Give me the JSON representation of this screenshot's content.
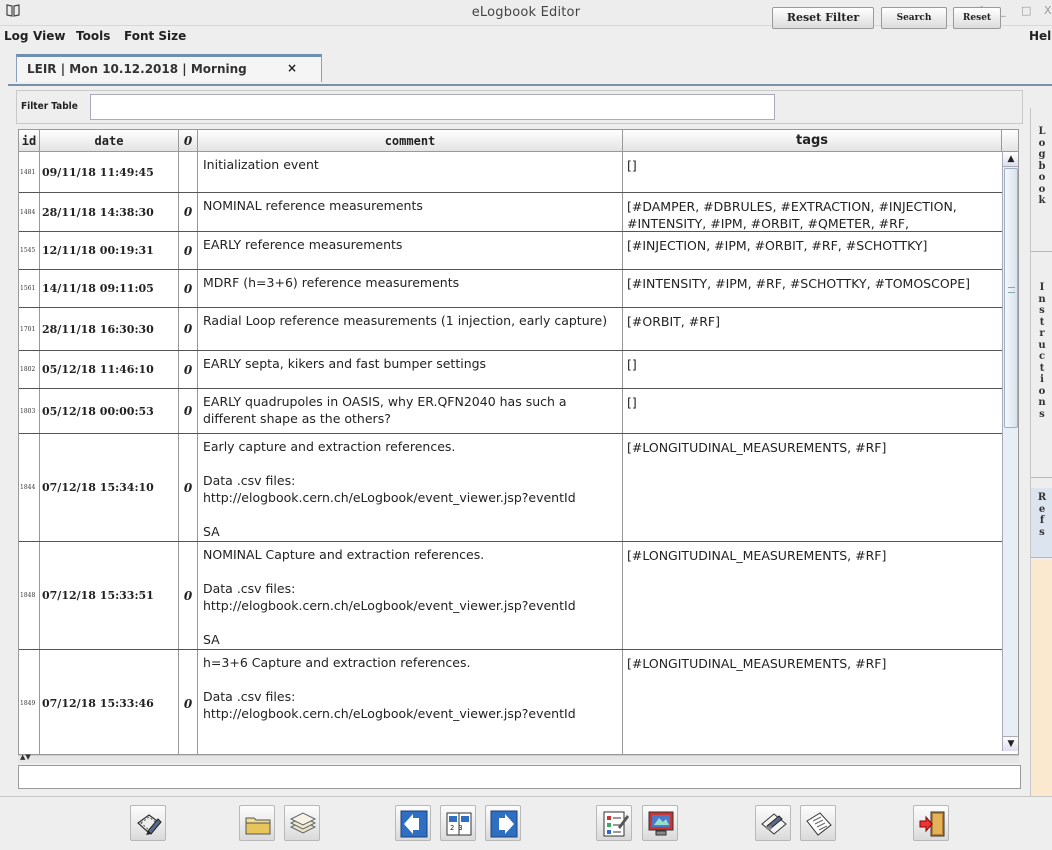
{
  "window": {
    "title": "eLogbook Editor",
    "right_menu": "Help"
  },
  "menu": {
    "items": [
      "Log",
      "View",
      "Tools",
      "Font Size"
    ]
  },
  "doc_tab": {
    "label": "LEIR | Mon 10.12.2018 | Morning",
    "close": "×"
  },
  "filter": {
    "label": "Filter Table",
    "value": "",
    "reset_filter": "Reset Filter",
    "search": "Search",
    "reset": "Reset"
  },
  "table": {
    "headers": {
      "id": "id",
      "date": "date",
      "attach": "0",
      "comment": "comment",
      "tags": "tags"
    },
    "rows": [
      {
        "id": "1481",
        "date": "09/11/18 11:49:45",
        "attach": "",
        "comment": "Initialization event",
        "tags": "[]"
      },
      {
        "id": "1484",
        "date": "28/11/18 14:38:30",
        "attach": "0",
        "comment": "NOMINAL reference measurements",
        "tags": "[#DAMPER, #DBRULES, #EXTRACTION, #INJECTION, #INTENSITY, #IPM, #ORBIT, #QMETER, #RF,"
      },
      {
        "id": "1545",
        "date": "12/11/18 00:19:31",
        "attach": "0",
        "comment": "EARLY reference measurements",
        "tags": "[#INJECTION, #IPM, #ORBIT, #RF, #SCHOTTKY]"
      },
      {
        "id": "1561",
        "date": "14/11/18 09:11:05",
        "attach": "0",
        "comment": "MDRF (h=3+6) reference measurements",
        "tags": "[#INTENSITY, #IPM, #RF, #SCHOTTKY, #TOMOSCOPE]"
      },
      {
        "id": "1701",
        "date": "28/11/18 16:30:30",
        "attach": "0",
        "comment": "Radial Loop reference measurements (1 injection, early capture)",
        "tags": "[#ORBIT, #RF]"
      },
      {
        "id": "1802",
        "date": "05/12/18 11:46:10",
        "attach": "0",
        "comment": "EARLY septa, kikers and fast bumper settings",
        "tags": "[]"
      },
      {
        "id": "1803",
        "date": "05/12/18 00:00:53",
        "attach": "0",
        "comment": "EARLY quadrupoles in OASIS, why ER.QFN2040 has such a different shape as the others?",
        "tags": "[]"
      },
      {
        "id": "1844",
        "date": "07/12/18 15:34:10",
        "attach": "0",
        "comment": "Early capture and extraction references.\n\nData .csv files:\nhttp://elogbook.cern.ch/eLogbook/event_viewer.jsp?eventId\n\nSA",
        "tags": "[#LONGITUDINAL_MEASUREMENTS, #RF]"
      },
      {
        "id": "1848",
        "date": "07/12/18 15:33:51",
        "attach": "0",
        "comment": "NOMINAL Capture and extraction references.\n\nData .csv files:\nhttp://elogbook.cern.ch/eLogbook/event_viewer.jsp?eventId\n\nSA",
        "tags": "[#LONGITUDINAL_MEASUREMENTS, #RF]"
      },
      {
        "id": "1849",
        "date": "07/12/18 15:33:46",
        "attach": "0",
        "comment": "h=3+6 Capture and extraction references.\n\nData .csv files:\nhttp://elogbook.cern.ch/eLogbook/event_viewer.jsp?eventId",
        "tags": "[#LONGITUDINAL_MEASUREMENTS, #RF]"
      }
    ]
  },
  "side_tabs": {
    "logbook": "Logbook",
    "instructions": "Instructions",
    "refs": "Refs"
  },
  "toolbar": {
    "icons": [
      "edit-event-icon",
      "open-folder-icon",
      "stack-icon",
      "previous-icon",
      "calendar-icon",
      "next-icon",
      "checklist-icon",
      "monitor-icon",
      "sign-icon",
      "notes-icon",
      "exit-icon"
    ]
  },
  "colors": {
    "tab_accent": "#6f8fb0",
    "refs_tab": "#dbe4ef",
    "side_note": "#fbe9cf"
  }
}
